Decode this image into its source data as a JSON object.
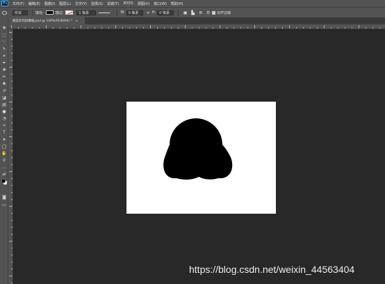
{
  "app": {
    "logo": "Ps"
  },
  "menu": [
    "文件(F)",
    "编辑(E)",
    "图像(I)",
    "图层(L)",
    "文字(Y)",
    "选择(S)",
    "滤镜(T)",
    "3D(D)",
    "视图(V)",
    "窗口(W)",
    "帮助(H)"
  ],
  "options": {
    "mode_label": "形状",
    "fill_label": "填充:",
    "stroke_label": "描边:",
    "stroke_width": "1 像素",
    "w_label": "W:",
    "w_value": "0 像素",
    "h_label": "H:",
    "h_value": "0 像素",
    "align_edges_label": "对齐边缘",
    "fill_color": "#000000"
  },
  "document": {
    "tab_title": "最美的的屏幕幅.psd @ 100%(RGB/8#) *",
    "close_glyph": "×",
    "canvas_color": "#ffffff",
    "shape_color": "#000000"
  },
  "tools": [
    "move-icon",
    "marquee-icon",
    "lasso-icon",
    "quick-select-icon",
    "crop-icon",
    "eyedropper-icon",
    "healing-brush-icon",
    "brush-icon",
    "clone-stamp-icon",
    "history-brush-icon",
    "eraser-icon",
    "gradient-icon",
    "blur-icon",
    "dodge-icon",
    "pen-icon",
    "type-icon",
    "path-select-icon",
    "shape-icon",
    "hand-icon",
    "zoom-icon",
    "more-tools-icon",
    "swap-colors-icon",
    "color-swatches-icon",
    "quick-mask-icon",
    "screen-mode-icon"
  ],
  "watermark": "https://blog.csdn.net/weixin_44563404"
}
